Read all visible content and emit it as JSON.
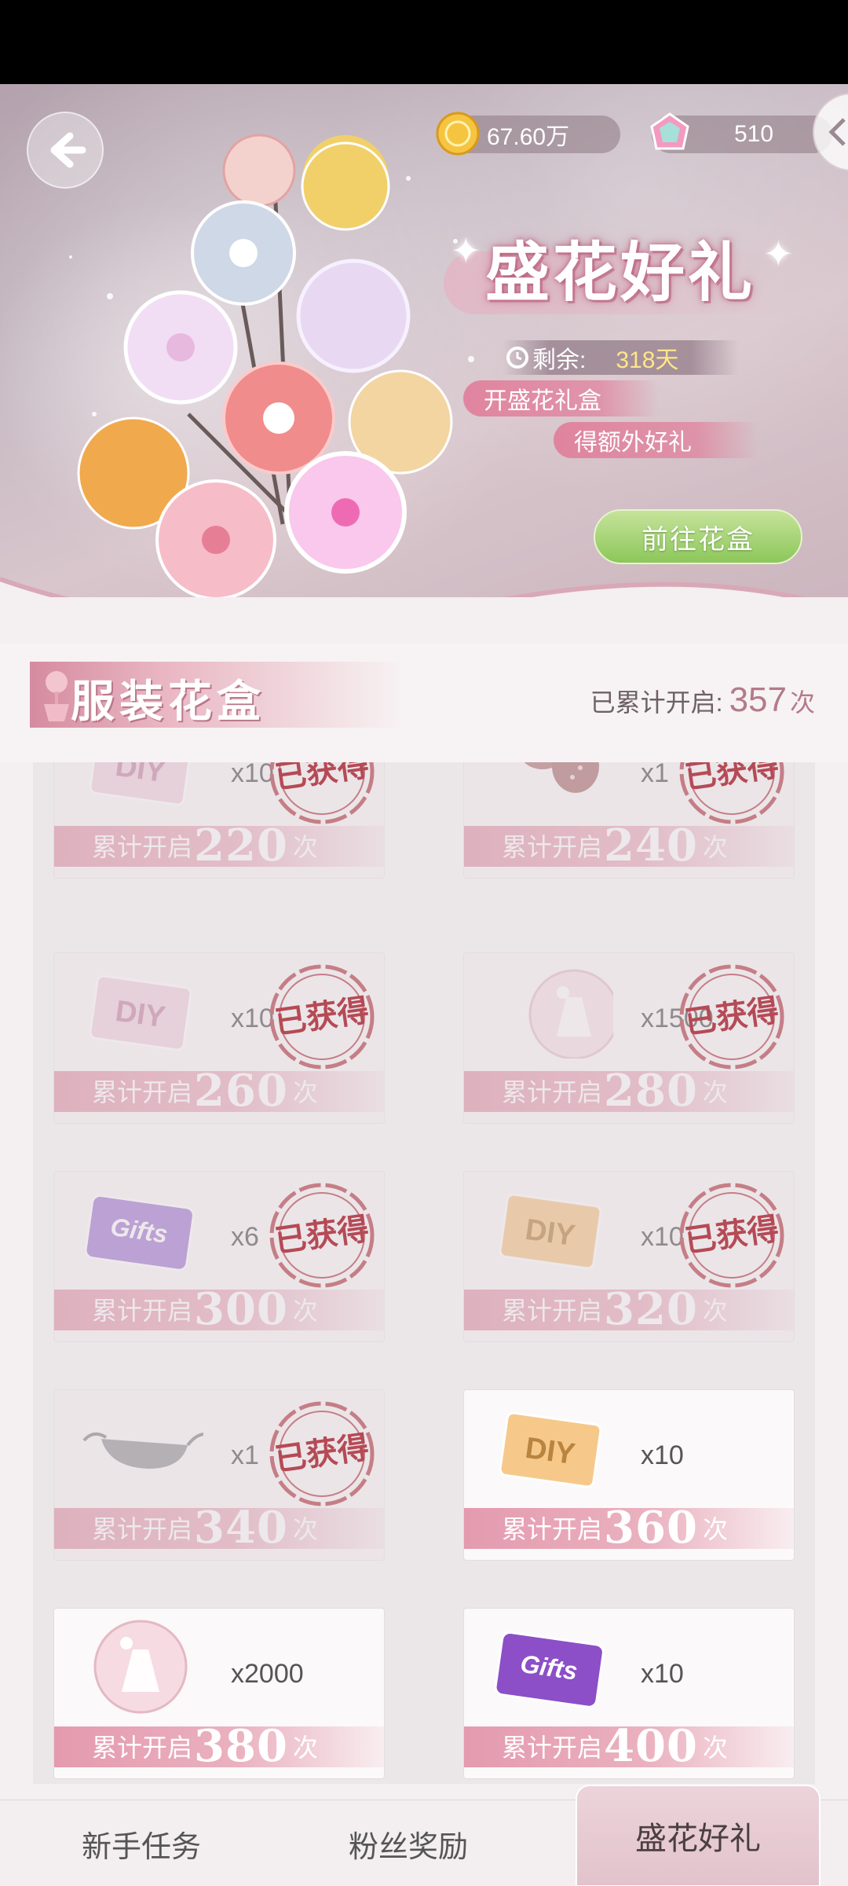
{
  "currency": {
    "coins": "67.60万",
    "gems": "510"
  },
  "event": {
    "title": "盛花好礼",
    "remaining_label": "剩余:",
    "remaining_days": "318天",
    "desc_line1": "开盛花礼盒",
    "desc_line2": "得额外好礼",
    "goto_button": "前往花盒"
  },
  "section": {
    "title": "服装花盒",
    "cumulative_label": "已累计开启:",
    "cumulative_count": "357",
    "cumulative_unit": "次"
  },
  "rewards": {
    "prefix": "累计开启",
    "suffix": "次",
    "stamp_text": "已获得",
    "items": [
      {
        "threshold": "220",
        "qty": "x10",
        "item": "diy-card-pink",
        "obtained": true
      },
      {
        "threshold": "240",
        "qty": "x1",
        "item": "strawberry-accessory",
        "obtained": true
      },
      {
        "threshold": "260",
        "qty": "x10",
        "item": "diy-card-pink",
        "obtained": true
      },
      {
        "threshold": "280",
        "qty": "x1500",
        "item": "dress-bubble",
        "obtained": true
      },
      {
        "threshold": "300",
        "qty": "x6",
        "item": "gift-card-purple",
        "obtained": true
      },
      {
        "threshold": "320",
        "qty": "x10",
        "item": "diy-card-gold",
        "obtained": true
      },
      {
        "threshold": "340",
        "qty": "x1",
        "item": "glasses-accessory",
        "obtained": true
      },
      {
        "threshold": "360",
        "qty": "x10",
        "item": "diy-card-gold",
        "obtained": false
      },
      {
        "threshold": "380",
        "qty": "x2000",
        "item": "dress-bubble",
        "obtained": false
      },
      {
        "threshold": "400",
        "qty": "x10",
        "item": "gift-card-purple",
        "obtained": false
      }
    ]
  },
  "tabs": [
    {
      "label": "新手任务"
    },
    {
      "label": "粉丝奖励"
    },
    {
      "label": "盛花好礼",
      "active": true
    }
  ],
  "colors": {
    "accent_pink": "#e49aae",
    "stamp_red": "#b54a55",
    "button_green": "#8cc75a",
    "days_yellow": "#ffe58a"
  }
}
